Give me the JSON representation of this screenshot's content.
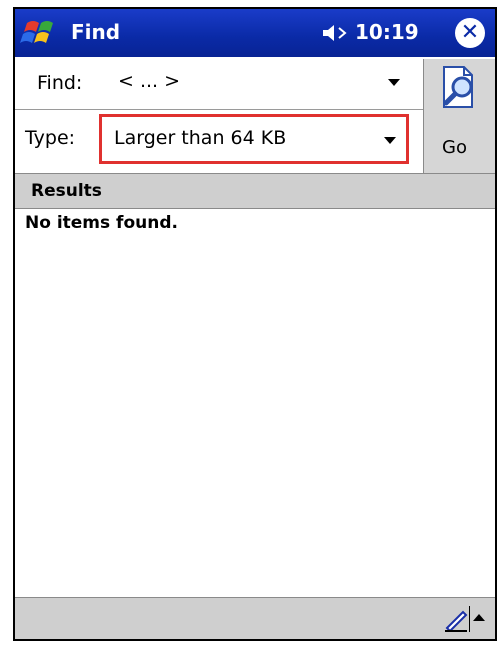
{
  "titlebar": {
    "app_title": "Find",
    "time": "10:19",
    "close_glyph": "✕",
    "icons": [
      "windows-start-icon",
      "speaker-icon",
      "close-icon"
    ]
  },
  "find_row": {
    "label": "Find:",
    "value": "< ... >"
  },
  "type_row": {
    "label": "Type:",
    "value": "Larger than 64 KB"
  },
  "go_button": {
    "label": "Go",
    "icon": "search-document-icon"
  },
  "results": {
    "header": "Results",
    "empty_message": "No items found."
  },
  "bottombar": {
    "icons": [
      "pen-input-icon",
      "sip-arrow-up-icon"
    ]
  },
  "colors": {
    "titlebar": "#0a2aa6",
    "highlight_border": "#e0312f",
    "panel_gray": "#cfcfcf"
  }
}
